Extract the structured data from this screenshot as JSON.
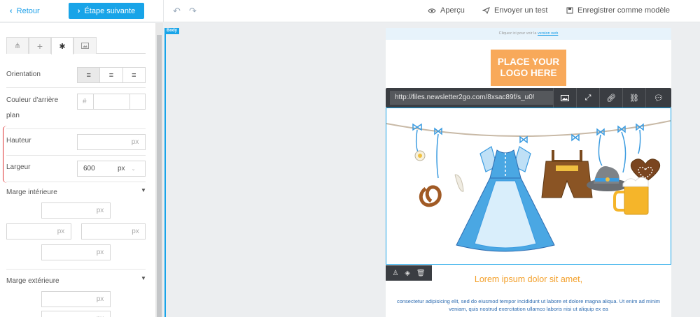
{
  "topbar": {
    "back_label": "Retour",
    "next_label": "Étape suivante",
    "preview_label": "Aperçu",
    "send_test_label": "Envoyer un test",
    "save_template_label": "Enregistrer comme modèle"
  },
  "sidebar": {
    "tabs": [
      "structure",
      "add",
      "settings",
      "image"
    ],
    "active_tab": "settings",
    "orientation_label": "Orientation",
    "bg_color_label": "Couleur d'arrière plan",
    "bg_color_hash": "#",
    "bg_color_value": "",
    "height_label": "Hauteur",
    "height_value": "",
    "height_unit": "px",
    "width_label": "Largeur",
    "width_value": "600",
    "width_unit": "px",
    "padding_label": "Marge intérieure",
    "padding_unit": "px",
    "margin_label": "Marge extérieure",
    "margin_unit": "px"
  },
  "canvas": {
    "body_badge": "Body",
    "preheader_text": "Cliquez ici pour voir la",
    "preheader_link": "version web",
    "logo_text": "PLACE YOUR LOGO HERE",
    "image_url": "http://files.newsletter2go.com/8xsac89f/s_u0!",
    "heading": "Lorem ipsum dolor sit amet,",
    "paragraph": "consectetur adipisicing elit, sed do eiusmod tempor incididunt ut labore et dolore magna aliqua. Ut enim ad minim veniam, quis nostrud exercitation ullamco laboris nisi ut aliquip ex ea"
  },
  "colors": {
    "accent": "#18a4e8",
    "logo_bg": "#f8a95a",
    "heading": "#f3a02b",
    "toolbar_bg": "#3a3d42"
  }
}
